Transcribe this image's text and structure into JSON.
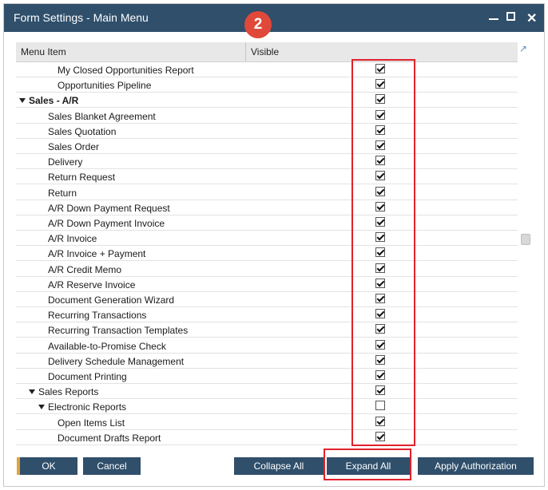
{
  "window": {
    "title": "Form Settings - Main Menu",
    "badge": "2"
  },
  "grid": {
    "col_menu_item": "Menu Item",
    "col_visible": "Visible",
    "rows": [
      {
        "label": "My Closed Opportunities Report",
        "indent": 3,
        "expand": false,
        "bold": false,
        "checked": true
      },
      {
        "label": "Opportunities Pipeline",
        "indent": 3,
        "expand": false,
        "bold": false,
        "checked": true
      },
      {
        "label": "Sales - A/R",
        "indent": 0,
        "expand": true,
        "bold": true,
        "checked": true
      },
      {
        "label": "Sales Blanket Agreement",
        "indent": 2,
        "expand": false,
        "bold": false,
        "checked": true
      },
      {
        "label": "Sales Quotation",
        "indent": 2,
        "expand": false,
        "bold": false,
        "checked": true
      },
      {
        "label": "Sales Order",
        "indent": 2,
        "expand": false,
        "bold": false,
        "checked": true
      },
      {
        "label": "Delivery",
        "indent": 2,
        "expand": false,
        "bold": false,
        "checked": true
      },
      {
        "label": "Return Request",
        "indent": 2,
        "expand": false,
        "bold": false,
        "checked": true
      },
      {
        "label": "Return",
        "indent": 2,
        "expand": false,
        "bold": false,
        "checked": true
      },
      {
        "label": "A/R Down Payment Request",
        "indent": 2,
        "expand": false,
        "bold": false,
        "checked": true
      },
      {
        "label": "A/R Down Payment Invoice",
        "indent": 2,
        "expand": false,
        "bold": false,
        "checked": true
      },
      {
        "label": "A/R Invoice",
        "indent": 2,
        "expand": false,
        "bold": false,
        "checked": true
      },
      {
        "label": "A/R Invoice + Payment",
        "indent": 2,
        "expand": false,
        "bold": false,
        "checked": true
      },
      {
        "label": "A/R Credit Memo",
        "indent": 2,
        "expand": false,
        "bold": false,
        "checked": true
      },
      {
        "label": "A/R Reserve Invoice",
        "indent": 2,
        "expand": false,
        "bold": false,
        "checked": true
      },
      {
        "label": "Document Generation Wizard",
        "indent": 2,
        "expand": false,
        "bold": false,
        "checked": true
      },
      {
        "label": "Recurring Transactions",
        "indent": 2,
        "expand": false,
        "bold": false,
        "checked": true
      },
      {
        "label": "Recurring Transaction Templates",
        "indent": 2,
        "expand": false,
        "bold": false,
        "checked": true
      },
      {
        "label": "Available-to-Promise Check",
        "indent": 2,
        "expand": false,
        "bold": false,
        "checked": true
      },
      {
        "label": "Delivery Schedule Management",
        "indent": 2,
        "expand": false,
        "bold": false,
        "checked": true
      },
      {
        "label": "Document Printing",
        "indent": 2,
        "expand": false,
        "bold": false,
        "checked": true
      },
      {
        "label": "Sales Reports",
        "indent": 1,
        "expand": true,
        "bold": false,
        "checked": true
      },
      {
        "label": "Electronic Reports",
        "indent": 2,
        "expand": true,
        "bold": false,
        "checked": false
      },
      {
        "label": "Open Items List",
        "indent": 3,
        "expand": false,
        "bold": false,
        "checked": true
      },
      {
        "label": "Document Drafts Report",
        "indent": 3,
        "expand": false,
        "bold": false,
        "checked": true
      }
    ]
  },
  "footer": {
    "ok": "OK",
    "cancel": "Cancel",
    "collapse_all": "Collapse All",
    "expand_all": "Expand All",
    "apply_authorization": "Apply Authorization"
  },
  "colors": {
    "titlebar": "#2f4f6b",
    "badge": "#e0483a",
    "highlight": "#e0222a",
    "button": "#2f4f6b"
  }
}
